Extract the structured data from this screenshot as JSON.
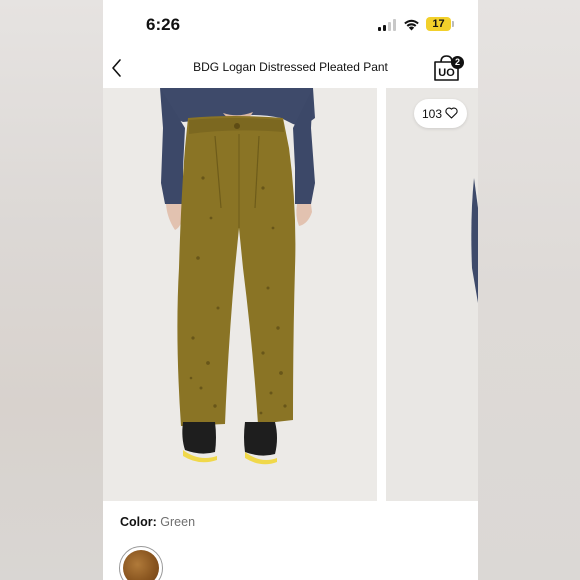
{
  "status_bar": {
    "time": "6:26",
    "battery": "17",
    "battery_color": "#f2d02b"
  },
  "nav": {
    "title": "BDG Logan Distressed Pleated Pant",
    "bag_count": "2",
    "bag_logo": "UO"
  },
  "gallery": {
    "likes": "103"
  },
  "color": {
    "label": "Color:",
    "value": "Green"
  },
  "icons": [
    "signal-icon",
    "wifi-icon",
    "back-icon",
    "shopping-bag-icon",
    "heart-icon"
  ]
}
